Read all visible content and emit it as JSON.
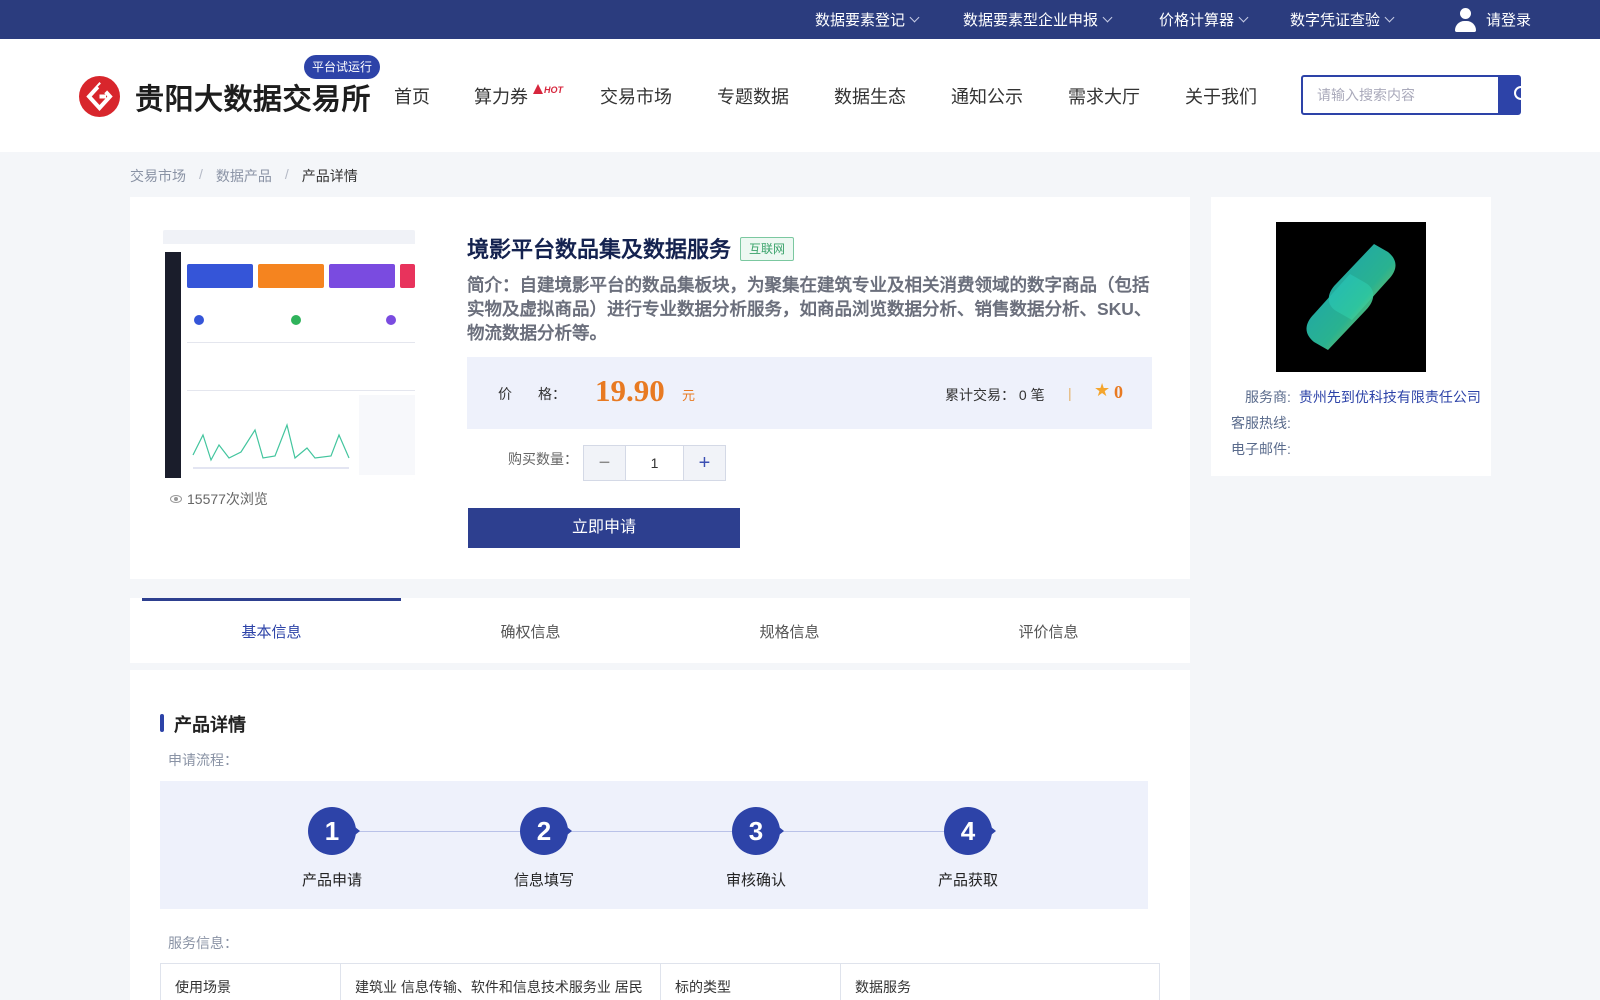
{
  "topbar": {
    "items": [
      {
        "label": "数据要素登记"
      },
      {
        "label": "数据要素型企业申报"
      },
      {
        "label": "价格计算器"
      },
      {
        "label": "数字凭证查验"
      }
    ],
    "login": "请登录"
  },
  "header": {
    "brand": "贵阳大数据交易所",
    "trial_badge": "平台试运行",
    "nav": [
      "首页",
      "算力券",
      "交易市场",
      "专题数据",
      "数据生态",
      "通知公示",
      "需求大厅",
      "关于我们"
    ],
    "hot_label": "HOT",
    "search_placeholder": "请输入搜索内容"
  },
  "breadcrumb": [
    "交易市场",
    "数据产品",
    "产品详情"
  ],
  "breadcrumb_sep": "/",
  "product": {
    "title": "境影平台数品集及数据服务",
    "tag": "互联网",
    "intro": "简介：自建境影平台的数品集板块，为聚集在建筑专业及相关消费领域的数字商品（包括实物及虚拟商品）进行专业数据分析服务，如商品浏览数据分析、销售数据分析、SKU、物流数据分析等。",
    "price_label_a": "价",
    "price_label_b": "格：",
    "price": "19.90",
    "price_unit": "元",
    "trades": "累计交易：  0 笔",
    "pipe": "|",
    "rating": "0",
    "qty_label": "购买数量：",
    "qty": "1",
    "apply": "立即申请",
    "views": "15577次浏览"
  },
  "vendor": {
    "provider_label": "服务商:",
    "provider": "贵州先到优科技有限责任公司",
    "hotline_label": "客服热线:",
    "email_label": "电子邮件:"
  },
  "tabs": [
    "基本信息",
    "确权信息",
    "规格信息",
    "评价信息"
  ],
  "detail": {
    "title": "产品详情",
    "flow_label": "申请流程：",
    "steps": [
      {
        "num": "1",
        "label": "产品申请"
      },
      {
        "num": "2",
        "label": "信息填写"
      },
      {
        "num": "3",
        "label": "审核确认"
      },
      {
        "num": "4",
        "label": "产品获取"
      }
    ],
    "service_label": "服务信息：",
    "table": [
      {
        "k1": "使用场景",
        "v1": "建筑业 信息传输、软件和信息技术服务业 居民",
        "k2": "标的类型",
        "v2": "数据服务"
      }
    ]
  },
  "colors": {
    "primary": "#2d43a8",
    "topbar": "#2b3c7e",
    "price": "#e87a22",
    "logo_red": "#d8262c"
  }
}
